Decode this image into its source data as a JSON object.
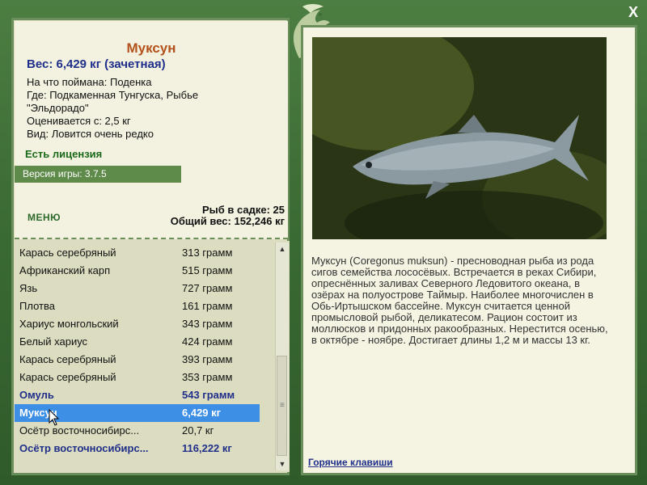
{
  "fish": {
    "title": "Муксун",
    "weight_line": "Вес: 6,429 кг (зачетная)",
    "caught_on": "На что поймана: Поденка",
    "location_line1": "Где: Подкаменная Тунгуска, Рыбье",
    "location_line2": "\"Эльдорадо\"",
    "price": "Оценивается с: 2,5 кг",
    "rarity": "Вид: Ловится очень редко",
    "description": "Муксун (Coregonus muksun) - пресноводная рыба из рода сигов семейства лососёвых. Встречается в реках Сибири, опреснённых заливах Северного Ледовитого океана, в озёрах на полуострове Таймыр. Наиболее многочислен в Обь-Иртышском бассейне. Муксун считается ценной промысловой рыбой, деликатесом. Рацион состоит из моллюсков и придонных ракообразных. Нерестится осенью, в октябре - ноябре. Достигает длины 1,2 м и массы 13 кг."
  },
  "license": "Есть лицензия",
  "version": "Версия игры: 3.7.5",
  "menu_label": "МЕНЮ",
  "stats": {
    "fish_count": "Рыб в садке: 25",
    "total_weight": "Общий вес: 152,246 кг"
  },
  "catch_list": [
    {
      "name": "Карась серебряный",
      "weight": "313 грамм",
      "bold": false,
      "selected": false
    },
    {
      "name": "Африканский карп",
      "weight": "515 грамм",
      "bold": false,
      "selected": false
    },
    {
      "name": "Язь",
      "weight": "727 грамм",
      "bold": false,
      "selected": false
    },
    {
      "name": "Плотва",
      "weight": "161 грамм",
      "bold": false,
      "selected": false
    },
    {
      "name": "Хариус монгольский",
      "weight": "343 грамм",
      "bold": false,
      "selected": false
    },
    {
      "name": "Белый хариус",
      "weight": "424 грамм",
      "bold": false,
      "selected": false
    },
    {
      "name": "Карась серебряный",
      "weight": "393 грамм",
      "bold": false,
      "selected": false
    },
    {
      "name": "Карась серебряный",
      "weight": "353 грамм",
      "bold": false,
      "selected": false
    },
    {
      "name": "Омуль",
      "weight": "543 грамм",
      "bold": true,
      "selected": false
    },
    {
      "name": "Муксун",
      "weight": "6,429 кг",
      "bold": true,
      "selected": true
    },
    {
      "name": "Осётр восточносибирс...",
      "weight": "20,7 кг",
      "bold": false,
      "selected": false
    },
    {
      "name": "Осётр восточносибирс...",
      "weight": "116,222 кг",
      "bold": true,
      "selected": false
    }
  ],
  "hotkeys_label": "Горячие клавиши",
  "close_label": "X",
  "colors": {
    "frame_green": "#3f6d36",
    "title_orange": "#b4521c",
    "weight_blue": "#1f2f8a",
    "license_green": "#1a6a1a",
    "selection_blue": "#3d8fe6"
  }
}
